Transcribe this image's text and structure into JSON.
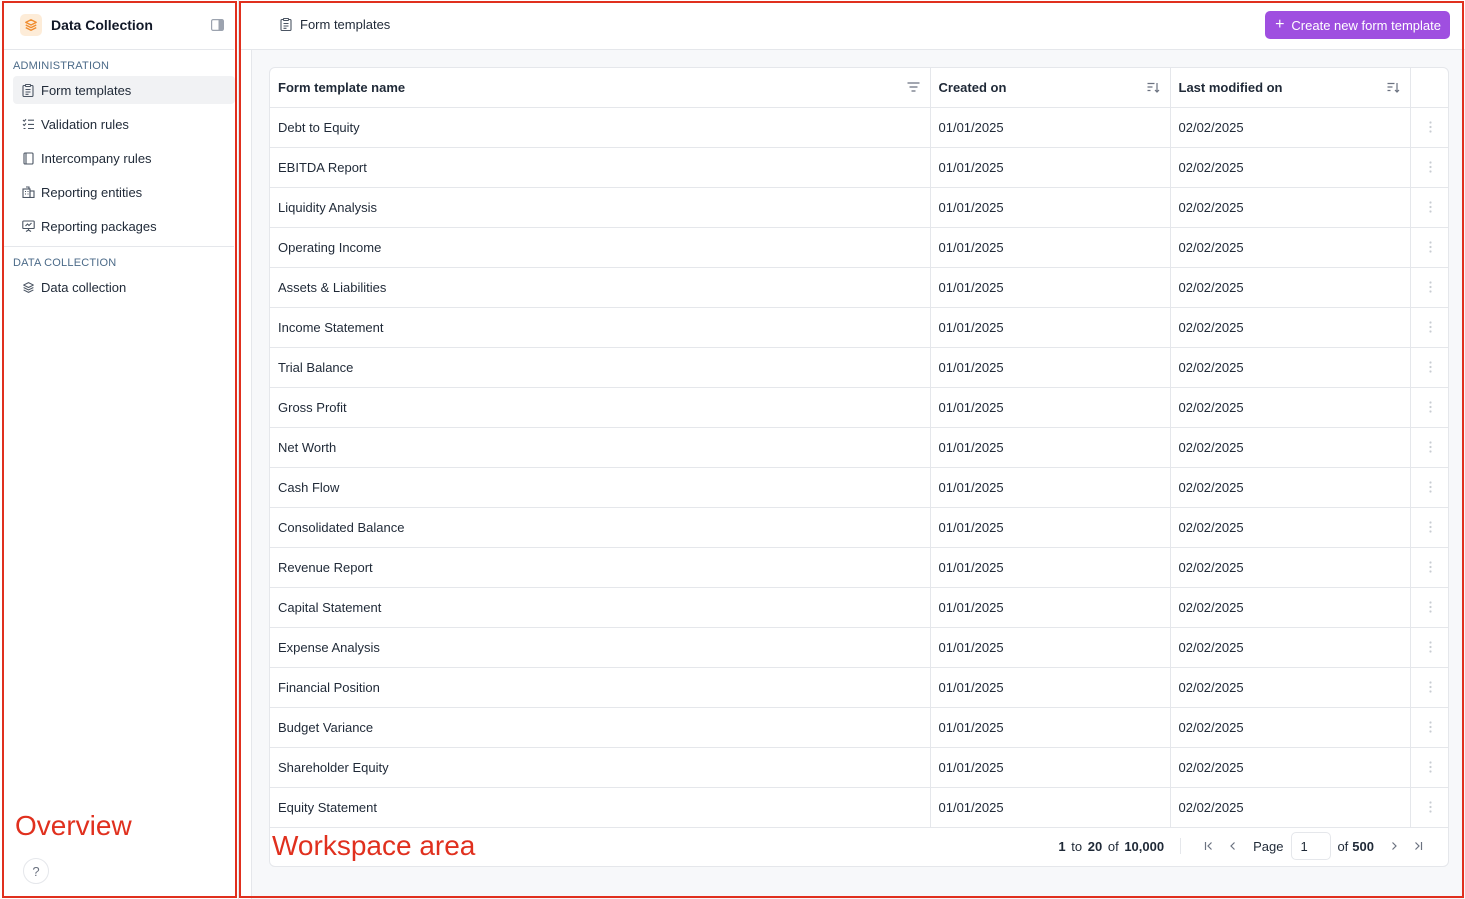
{
  "app": {
    "title": "Data Collection"
  },
  "sidebar": {
    "sections": [
      {
        "label": "ADMINISTRATION",
        "items": [
          {
            "label": "Form templates",
            "icon": "clipboard-icon",
            "active": true
          },
          {
            "label": "Validation rules",
            "icon": "checklist-icon"
          },
          {
            "label": "Intercompany rules",
            "icon": "document-icon"
          },
          {
            "label": "Reporting entities",
            "icon": "building-icon"
          },
          {
            "label": "Reporting packages",
            "icon": "presentation-icon"
          }
        ]
      },
      {
        "label": "DATA COLLECTION",
        "items": [
          {
            "label": "Data collection",
            "icon": "layers-icon"
          }
        ]
      }
    ],
    "help": "?"
  },
  "header": {
    "title": "Form templates",
    "create_button": "Create new form template"
  },
  "table": {
    "columns": [
      "Form template name",
      "Created on",
      "Last modified on"
    ],
    "rows": [
      {
        "name": "Debt to Equity",
        "created": "01/01/2025",
        "modified": "02/02/2025"
      },
      {
        "name": "EBITDA Report",
        "created": "01/01/2025",
        "modified": "02/02/2025"
      },
      {
        "name": "Liquidity Analysis",
        "created": "01/01/2025",
        "modified": "02/02/2025"
      },
      {
        "name": "Operating Income",
        "created": "01/01/2025",
        "modified": "02/02/2025"
      },
      {
        "name": "Assets & Liabilities",
        "created": "01/01/2025",
        "modified": "02/02/2025"
      },
      {
        "name": "Income Statement",
        "created": "01/01/2025",
        "modified": "02/02/2025"
      },
      {
        "name": "Trial Balance",
        "created": "01/01/2025",
        "modified": "02/02/2025"
      },
      {
        "name": "Gross Profit",
        "created": "01/01/2025",
        "modified": "02/02/2025"
      },
      {
        "name": "Net Worth",
        "created": "01/01/2025",
        "modified": "02/02/2025"
      },
      {
        "name": "Cash Flow",
        "created": "01/01/2025",
        "modified": "02/02/2025"
      },
      {
        "name": "Consolidated Balance",
        "created": "01/01/2025",
        "modified": "02/02/2025"
      },
      {
        "name": "Revenue Report",
        "created": "01/01/2025",
        "modified": "02/02/2025"
      },
      {
        "name": "Capital Statement",
        "created": "01/01/2025",
        "modified": "02/02/2025"
      },
      {
        "name": "Expense Analysis",
        "created": "01/01/2025",
        "modified": "02/02/2025"
      },
      {
        "name": "Financial Position",
        "created": "01/01/2025",
        "modified": "02/02/2025"
      },
      {
        "name": "Budget Variance",
        "created": "01/01/2025",
        "modified": "02/02/2025"
      },
      {
        "name": "Shareholder Equity",
        "created": "01/01/2025",
        "modified": "02/02/2025"
      },
      {
        "name": "Equity Statement",
        "created": "01/01/2025",
        "modified": "02/02/2025"
      }
    ]
  },
  "pagination": {
    "from": "1",
    "to_word": "to",
    "to": "20",
    "of_word": "of",
    "total": "10,000",
    "page_label": "Page",
    "page": "1",
    "pages_of": "of",
    "page_count": "500"
  },
  "annotations": {
    "left": "Overview",
    "right": "Workspace area",
    "color": "#e0301e"
  },
  "colors": {
    "accent": "#9f4fe0",
    "logo_bg": "#fdecd8",
    "logo_fg": "#f08c2e"
  }
}
